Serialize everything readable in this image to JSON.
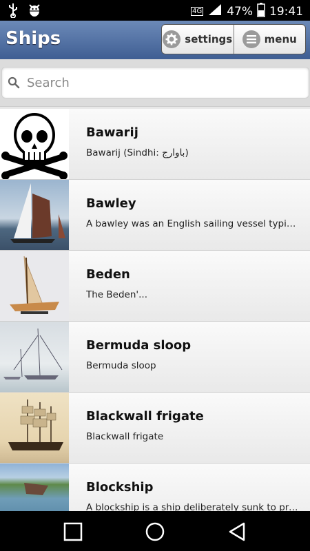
{
  "status_bar": {
    "network": "4G",
    "battery_percent": "47%",
    "time": "19:41",
    "icons": [
      "usb-icon",
      "android-debug-icon",
      "signal-icon",
      "battery-icon"
    ]
  },
  "app_bar": {
    "title": "Ships",
    "settings_label": "settings",
    "menu_label": "menu"
  },
  "search": {
    "placeholder": "Search",
    "value": ""
  },
  "items": [
    {
      "name": "Bawarij",
      "description": "Bawarij (Sindhi: باوارج)",
      "thumbnail": "skull-crossbones"
    },
    {
      "name": "Bawley",
      "description": "A bawley was an English sailing vessel typifi...",
      "thumbnail": "sailboat-photo"
    },
    {
      "name": "Beden",
      "description": "The Beden'...",
      "thumbnail": "model-boat-photo"
    },
    {
      "name": "Bermuda sloop",
      "description": "Bermuda sloop",
      "thumbnail": "sloop-painting"
    },
    {
      "name": "Blackwall frigate",
      "description": "Blackwall frigate",
      "thumbnail": "frigate-painting"
    },
    {
      "name": "Blockship",
      "description": "A blockship is a ship deliberately sunk to pre...",
      "thumbnail": "wreck-photo"
    }
  ],
  "colors": {
    "app_bar_top": "#6c8ab8",
    "app_bar_bottom": "#3f5e93",
    "list_bg": "#f2f2f2"
  }
}
